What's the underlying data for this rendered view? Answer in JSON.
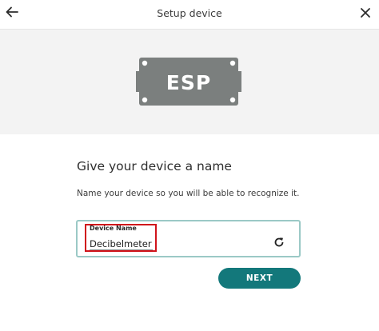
{
  "header": {
    "title": "Setup device",
    "back_icon": "arrow-left-icon",
    "close_icon": "close-icon"
  },
  "banner": {
    "chip_label": "ESP",
    "chip_color": "#7b7f7e",
    "background_color": "#f3f3f3"
  },
  "main": {
    "heading": "Give your device a name",
    "description": "Name your device so you will be able to recognize it."
  },
  "device_name_field": {
    "label": "Device Name",
    "value": "Decibelmeter",
    "border_color": "#9bc9c6",
    "highlight_color": "#d0141b",
    "refresh_icon": "refresh-icon"
  },
  "actions": {
    "next_label": "NEXT",
    "accent_color": "#13787b"
  }
}
